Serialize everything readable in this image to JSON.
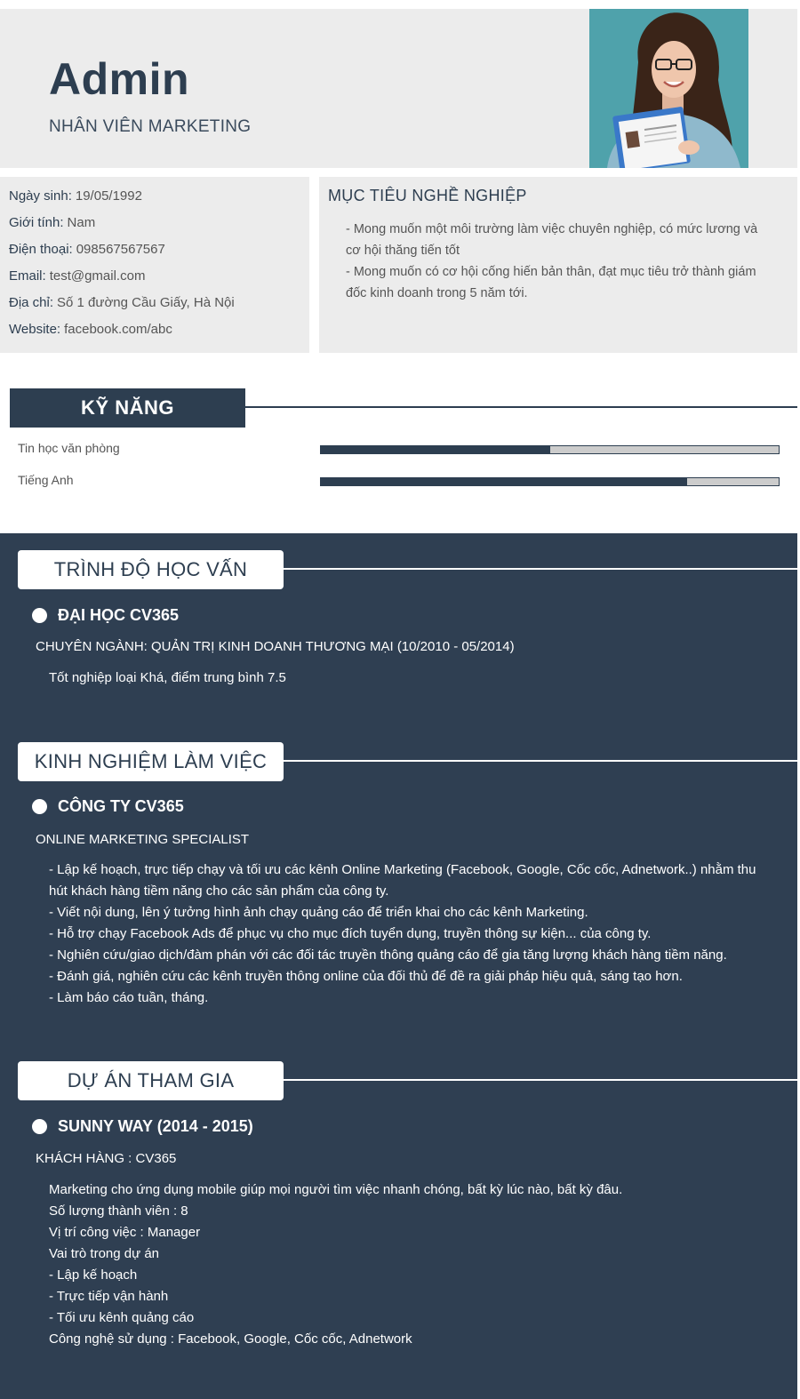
{
  "header": {
    "name": "Admin",
    "title": "NHÂN VIÊN MARKETING"
  },
  "info": [
    {
      "label": "Ngày sinh:",
      "value": "19/05/1992"
    },
    {
      "label": "Giới tính:",
      "value": "Nam"
    },
    {
      "label": "Điện thoại:",
      "value": "098567567567"
    },
    {
      "label": "Email:",
      "value": "test@gmail.com"
    },
    {
      "label": "Địa chỉ:",
      "value": "Số 1 đường Cầu Giấy, Hà Nội"
    },
    {
      "label": "Website:",
      "value": "facebook.com/abc"
    }
  ],
  "goal": {
    "title": "MỤC TIÊU NGHỀ NGHIỆP",
    "lines": [
      "- Mong muốn một môi trường làm việc chuyên nghiệp, có mức lương và cơ hội thăng tiến tốt",
      "- Mong muốn có cơ hội cống hiến bản thân, đạt mục tiêu trở thành giám đốc kinh doanh trong 5 năm tới."
    ]
  },
  "skills": {
    "title": "KỸ NĂNG",
    "items": [
      {
        "name": "Tin học văn phòng",
        "level": 0.5
      },
      {
        "name": "Tiếng Anh",
        "level": 0.8
      }
    ]
  },
  "education": {
    "title": "TRÌNH ĐỘ HỌC VẤN",
    "school": "ĐẠI HỌC CV365",
    "major": "CHUYÊN NGÀNH: QUẢN TRỊ KINH DOANH THƯƠNG MẠI (10/2010 - 05/2014)",
    "desc": "Tốt nghiệp loại Khá, điểm trung bình 7.5"
  },
  "experience": {
    "title": "KINH NGHIỆM LÀM VIỆC",
    "company": "CÔNG TY CV365",
    "position": "ONLINE MARKETING SPECIALIST",
    "lines": [
      "- Lập kế hoạch, trực tiếp chạy và tối ưu các kênh Online Marketing (Facebook, Google, Cốc cốc, Adnetwork..) nhằm thu hút khách hàng tiềm năng cho các sản phẩm của công ty.",
      "- Viết nội dung, lên ý tưởng hình ảnh chạy quảng cáo để triển khai cho các kênh Marketing.",
      "- Hỗ trợ chạy Facebook Ads để phục vụ cho mục đích tuyển dụng, truyền thông sự kiện... của công ty.",
      "- Nghiên cứu/giao dịch/đàm phán với các đối tác truyền thông quảng cáo để gia tăng lượng khách hàng tiềm năng.",
      "- Đánh giá, nghiên cứu các kênh truyền thông online của đối thủ để đề ra giải pháp hiệu quả, sáng tạo hơn.",
      "- Làm báo cáo tuần, tháng."
    ]
  },
  "projects": {
    "title": "DỰ ÁN THAM GIA",
    "name": "SUNNY WAY (2014 - 2015)",
    "client": "KHÁCH HÀNG : CV365",
    "lines": [
      "Marketing cho ứng dụng mobile giúp mọi người tìm việc nhanh chóng, bất kỳ lúc nào, bất kỳ đâu.",
      "Số lượng thành viên : 8",
      "Vị trí công việc : Manager",
      "Vai trò trong dự án",
      "- Lập kế hoạch",
      "- Trực tiếp vận hành",
      "- Tối ưu kênh quảng cáo",
      "Công nghệ sử dụng : Facebook, Google, Cốc cốc, Adnetwork"
    ]
  },
  "colors": {
    "primary": "#2d3e50",
    "dark_bg": "#2f3f52",
    "light_bg": "#ececec"
  }
}
